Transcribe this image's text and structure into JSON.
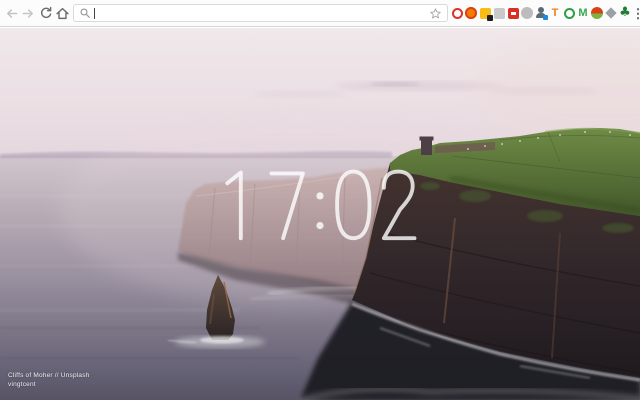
{
  "browser": {
    "toolbar": {
      "back_icon": "back-arrow-icon",
      "forward_icon": "forward-arrow-icon",
      "reload_icon": "reload-icon",
      "home_icon": "home-icon",
      "address_bar": {
        "value": "",
        "placeholder": "",
        "search_icon": "magnifier-icon",
        "bookmark_icon": "star-outline-icon"
      },
      "extensions": [
        {
          "name": "ext-red-ring-icon",
          "type": "ring",
          "color": "#d8342c"
        },
        {
          "name": "ext-orange-fire-icon",
          "type": "circle2",
          "color": "#f57c00",
          "inner": "#d84315"
        },
        {
          "name": "ext-yellow-badged-icon",
          "type": "badge",
          "color": "#f9bc15",
          "badge_color": "#1c1c1c"
        },
        {
          "name": "ext-gray-square-icon",
          "type": "square",
          "color": "#c9c9c9"
        },
        {
          "name": "ext-red-square-icon",
          "type": "square",
          "color": "#d93025",
          "inner": "#ffffff"
        },
        {
          "name": "ext-gray-circle-icon",
          "type": "circle",
          "color": "#bcbcbc"
        },
        {
          "name": "ext-person-blue-icon",
          "type": "person",
          "color": "#5c6a73",
          "accent": "#1e88e5"
        },
        {
          "name": "ext-orange-letter-icon",
          "type": "letter",
          "label": "T",
          "color": "#ef7c1a"
        },
        {
          "name": "ext-green-ring-icon",
          "type": "ring",
          "color": "#2e9e49"
        },
        {
          "name": "ext-green-m-icon",
          "type": "letter",
          "label": "M",
          "color": "#34a853"
        },
        {
          "name": "ext-red-green-circle-icon",
          "type": "split",
          "top": "#d84315",
          "bottom": "#7cb342"
        },
        {
          "name": "ext-gray-pinwheel-icon",
          "type": "diamond",
          "color": "#9aa0a6"
        },
        {
          "name": "ext-green-clover-icon",
          "type": "clover",
          "color": "#1e7e34"
        }
      ],
      "menu_icon": "kebab-menu-icon",
      "menu_glyph": "⋮"
    }
  },
  "page": {
    "clock": "17:02",
    "clock_color": "rgba(255,255,255,0.8)",
    "attribution": {
      "line1": "Cliffs of Moher // Unsplash",
      "line2": "vingtcent"
    }
  },
  "scene": {
    "subject": "Cliffs of Moher at sunset, sea stack and tower on headland",
    "palette": {
      "sky_top": "#f0e8eb",
      "sky_horizon": "#e4d6dd",
      "sea_top": "#d2c6ce",
      "sea_bottom": "#575364",
      "cliff_haze": "#c4aaa8",
      "cliff_dark": "#2b2225",
      "grass": "#5d7a38",
      "foam": "#ffffff"
    }
  }
}
